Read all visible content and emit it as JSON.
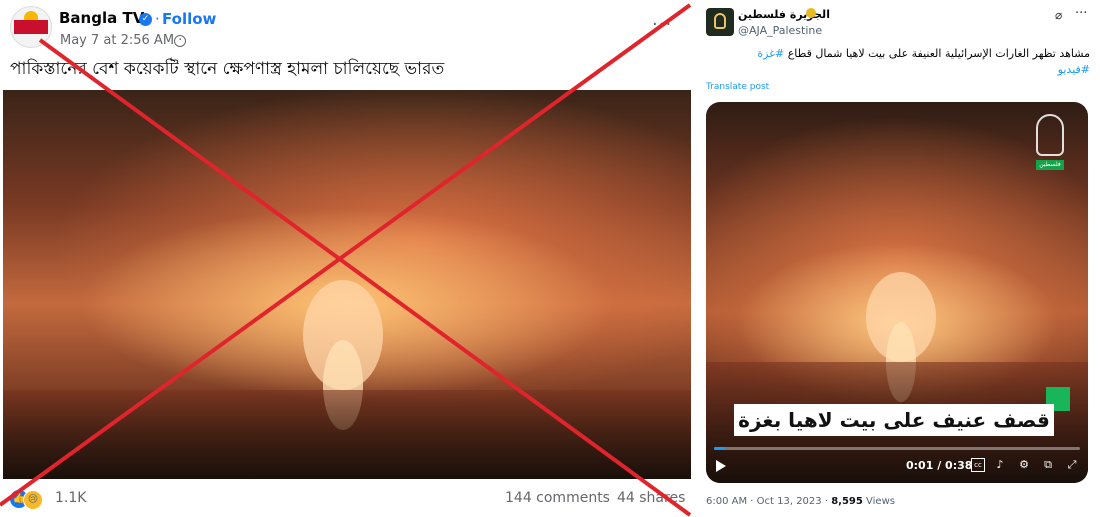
{
  "facebook_post": {
    "page_name": "Bangla TV",
    "follow_label": "Follow",
    "separator": "·",
    "timestamp": "May 7 at 2:56 AM ·",
    "caption": "পাকিস্তানের বেশ কয়েকটি স্থানে ক্ষেপণাস্ত্র হামলা চালিয়েছে ভারত",
    "reaction_count": "1.1K",
    "comments": "144 comments",
    "shares": "44 shares",
    "menu_glyph": "···"
  },
  "twitter_post": {
    "account_name": "الجزيرة فلسطين",
    "handle": "@AJA_Palestine",
    "text": "مشاهد تظهر الغارات الإسرائيلية العنيفة على بيت لاهيا شمال قطاع",
    "hashtag_1": "#غزة",
    "hashtag_2": "#فيديو",
    "translate_label": "Translate post",
    "video_caption": "قصف عنيف على بيت لاهيا بغزة",
    "channel_tag": "فلسطين",
    "timecode": "0:01 / 0:38",
    "progress": 0.03,
    "footer_date": "6:00 AM · Oct 13, 2023 ·",
    "views_count": "8,595",
    "views_label": "Views",
    "menu_glyph": "···"
  },
  "overlay": {
    "cross_color": "#e0242c"
  },
  "icons": [
    "verified-icon",
    "globe-icon",
    "like-icon",
    "care-icon",
    "play-icon",
    "cc-icon",
    "volume-icon",
    "settings-icon",
    "pip-icon",
    "fullscreen-icon",
    "grok-icon"
  ]
}
